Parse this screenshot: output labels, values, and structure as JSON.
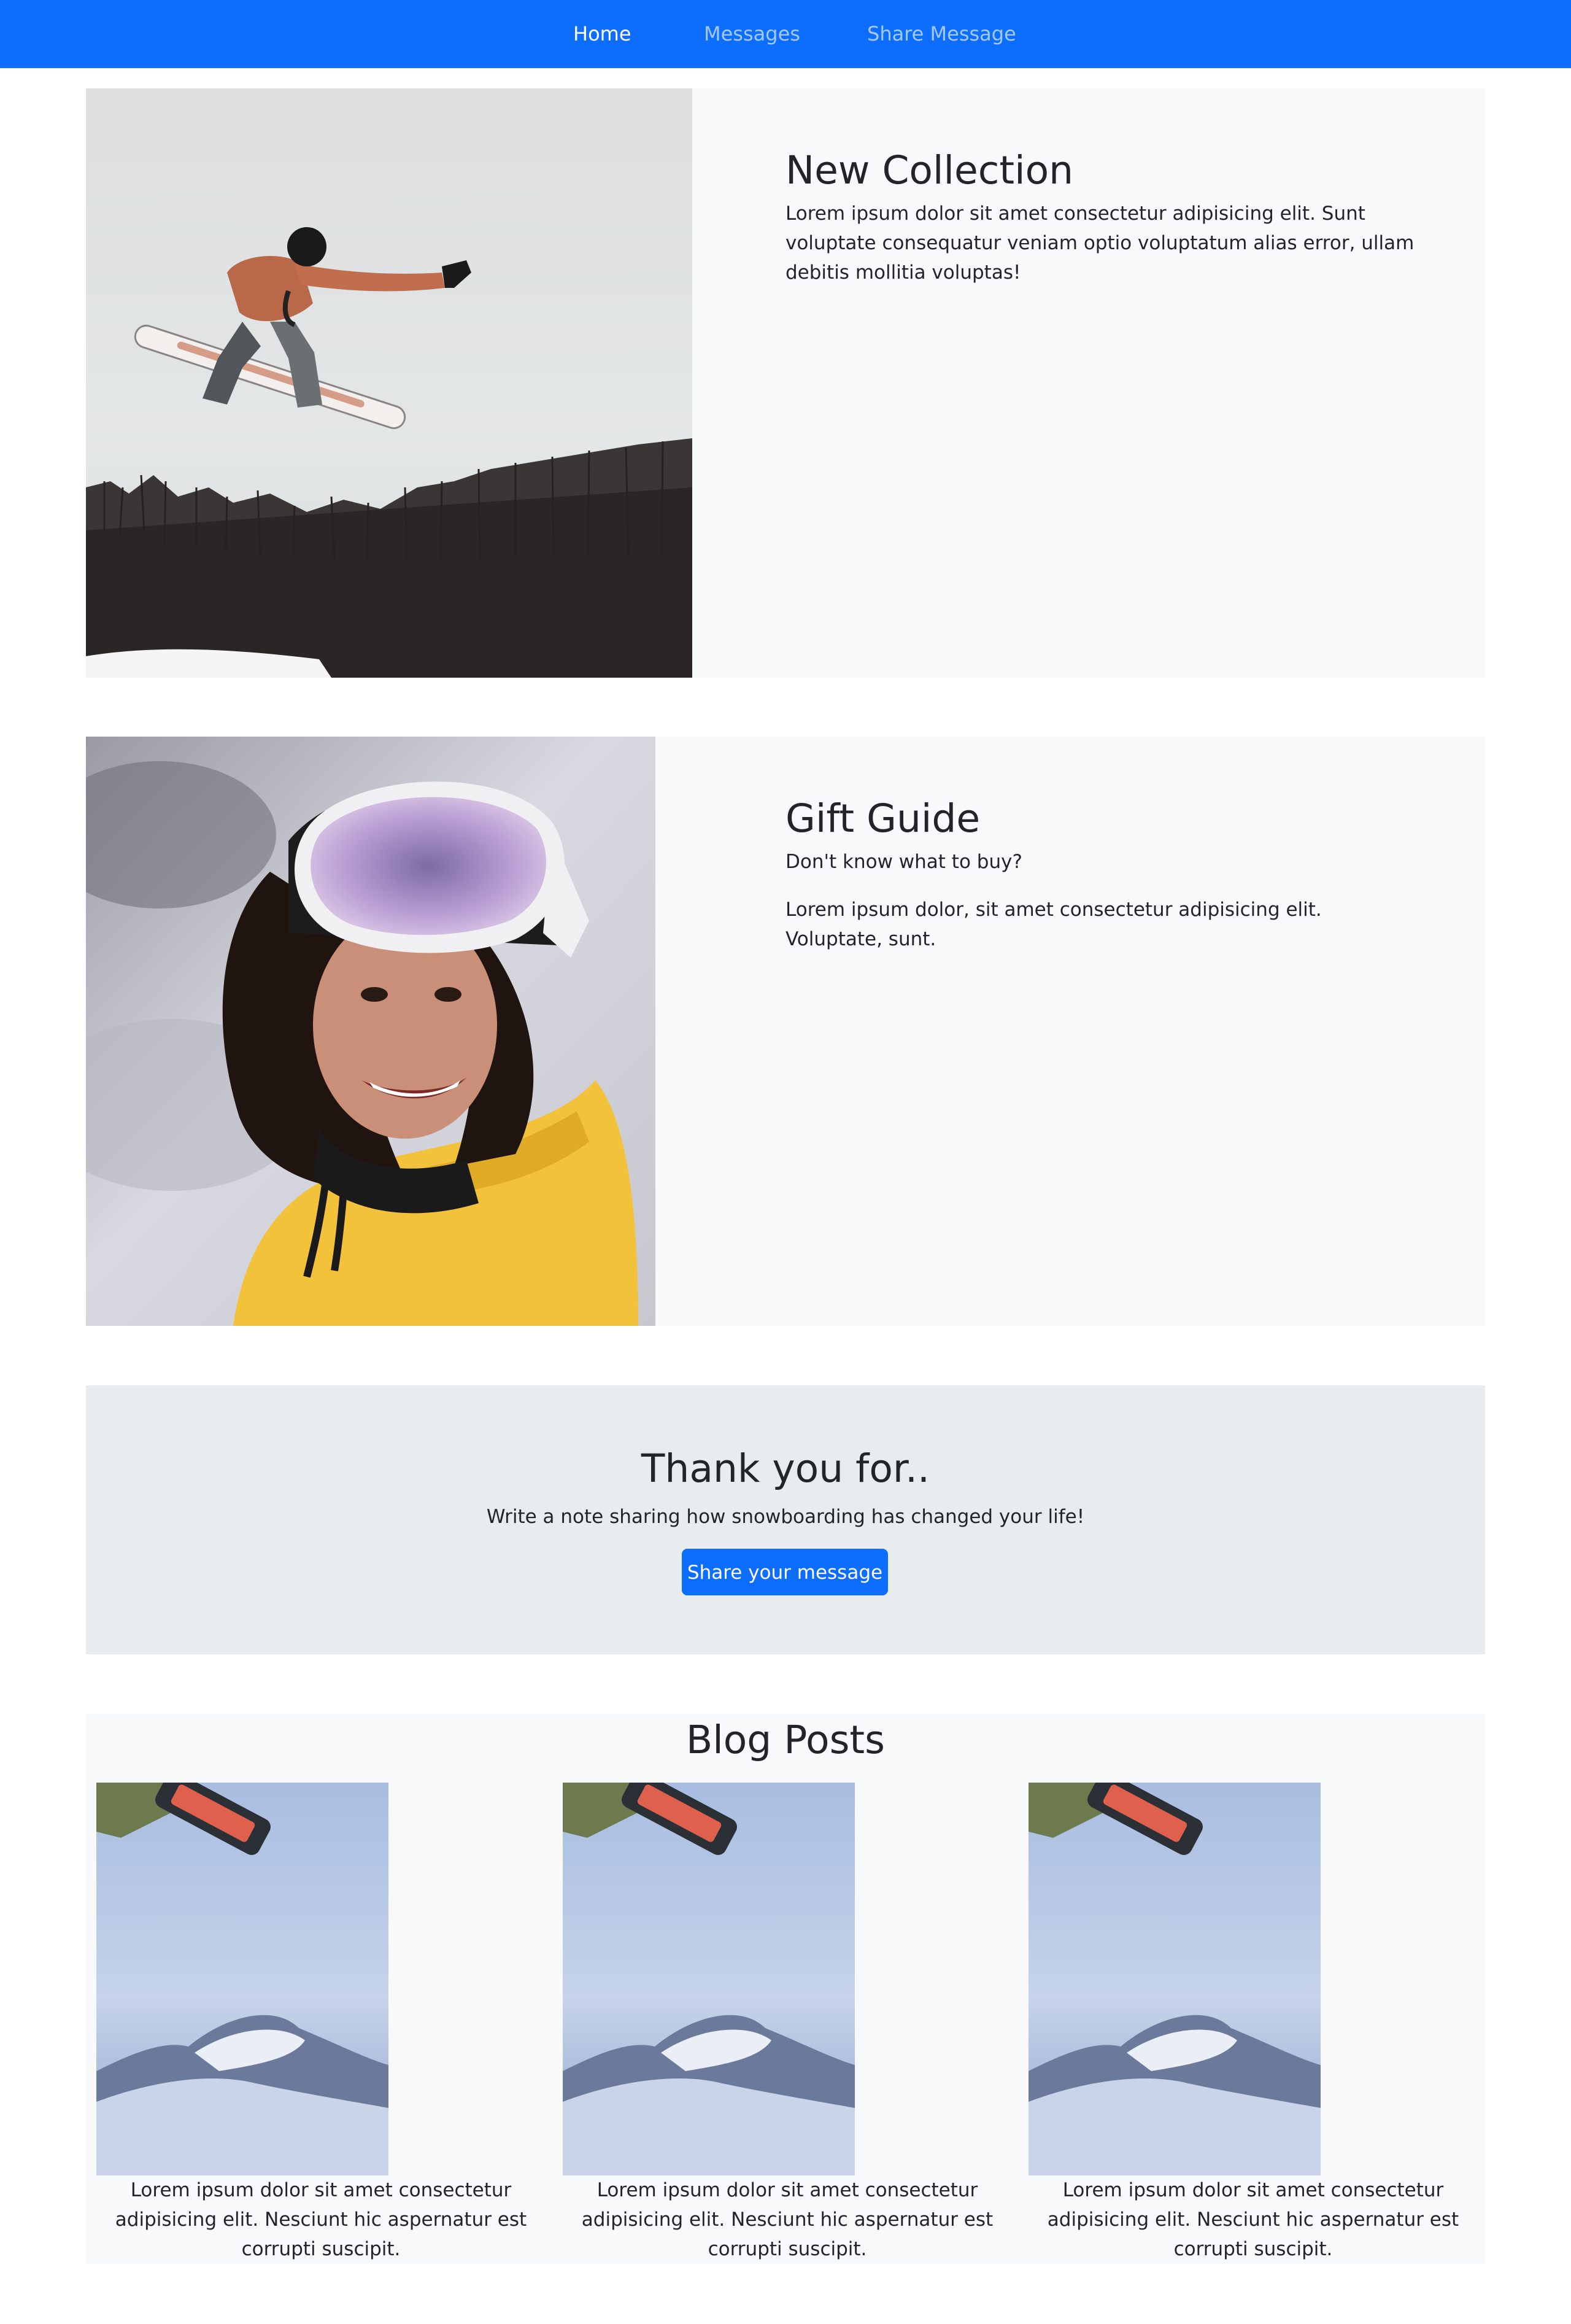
{
  "nav": {
    "items": [
      {
        "label": "Home",
        "active": true
      },
      {
        "label": "Messages",
        "active": false
      },
      {
        "label": "Share Message",
        "active": false
      }
    ]
  },
  "features": [
    {
      "title": "New Collection",
      "paragraphs": [
        "Lorem ipsum dolor sit amet consectetur adipisicing elit. Sunt voluptate consequatur veniam optio voluptatum alias error, ullam debitis mollitia voluptas!"
      ],
      "image": "snowboarder-jump-photo"
    },
    {
      "title": "Gift Guide",
      "paragraphs": [
        "Don't know what to buy?",
        "Lorem ipsum dolor, sit amet consectetur adipisicing elit. Voluptate, sunt."
      ],
      "image": "skier-portrait-photo"
    }
  ],
  "cta": {
    "title": "Thank you for..",
    "lead": "Write a note sharing how snowboarding has changed your life!",
    "button_label": "Share your message"
  },
  "blog": {
    "title": "Blog Posts",
    "posts": [
      {
        "text": "Lorem ipsum dolor sit amet consectetur adipisicing elit. Nesciunt hic aspernatur est corrupti suscipit.",
        "image": "snowboard-mountain-photo"
      },
      {
        "text": "Lorem ipsum dolor sit amet consectetur adipisicing elit. Nesciunt hic aspernatur est corrupti suscipit.",
        "image": "snowboard-mountain-photo"
      },
      {
        "text": "Lorem ipsum dolor sit amet consectetur adipisicing elit. Nesciunt hic aspernatur est corrupti suscipit.",
        "image": "snowboard-mountain-photo"
      }
    ]
  },
  "colors": {
    "primary": "#0d6efd",
    "light": "#f8f9fa",
    "cta_bg": "#e9ecef",
    "text": "#212529"
  }
}
